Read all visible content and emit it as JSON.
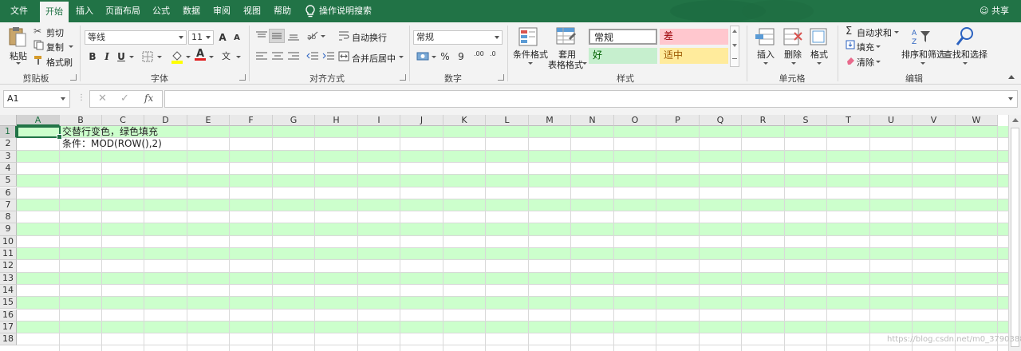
{
  "tabs": {
    "file": "文件",
    "home": "开始",
    "insert": "插入",
    "page_layout": "页面布局",
    "formulas": "公式",
    "data": "数据",
    "review": "审阅",
    "view": "视图",
    "help": "帮助",
    "tell_me": "操作说明搜索",
    "share": "共享"
  },
  "clipboard": {
    "paste": "粘贴",
    "cut": "剪切",
    "copy": "复制",
    "format_painter": "格式刷",
    "group": "剪贴板"
  },
  "font": {
    "name": "等线",
    "size": "11",
    "grow": "A",
    "shrink": "A",
    "bold": "B",
    "italic": "I",
    "underline": "U",
    "wen": "文",
    "group": "字体"
  },
  "alignment": {
    "wrap": "自动换行",
    "merge": "合并后居中",
    "group": "对齐方式"
  },
  "number": {
    "format": "常规",
    "percent": "%",
    "comma": "9",
    "inc": ".00",
    "dec": ".0",
    "group": "数字"
  },
  "styles": {
    "conditional": "条件格式",
    "table_line1": "套用",
    "table_line2": "表格格式",
    "normal": "常规",
    "bad": "差",
    "good": "好",
    "neutral": "适中",
    "group": "样式"
  },
  "cells": {
    "insert": "插入",
    "delete": "删除",
    "format": "格式",
    "group": "单元格"
  },
  "editing": {
    "autosum": "自动求和",
    "fill": "填充",
    "clear": "清除",
    "sort": "排序和筛选",
    "find": "查找和选择",
    "group": "编辑"
  },
  "formula_bar": {
    "name_box": "A1",
    "fx": "fx",
    "content": ""
  },
  "columns": [
    "A",
    "B",
    "C",
    "D",
    "E",
    "F",
    "G",
    "H",
    "I",
    "J",
    "K",
    "L",
    "M",
    "N",
    "O",
    "P",
    "Q",
    "R",
    "S",
    "T",
    "U",
    "V",
    "W"
  ],
  "rows": [
    "1",
    "2",
    "3",
    "4",
    "5",
    "6",
    "7",
    "8",
    "9",
    "10",
    "11",
    "12",
    "13",
    "14",
    "15",
    "16",
    "17",
    "18"
  ],
  "cells_content": {
    "b1": "交替行变色，绿色填充",
    "b2": "条件：MOD(ROW(),2)"
  },
  "colors": {
    "accent": "#217346",
    "band": "#ccffcc",
    "bad_bg": "#ffc7ce",
    "bad_fg": "#9c0006",
    "good_bg": "#c6efce",
    "good_fg": "#006100",
    "neutral_bg": "#ffeb9c",
    "neutral_fg": "#9c5700"
  },
  "watermark": "https://blog.csdn.net/m0_37903882"
}
